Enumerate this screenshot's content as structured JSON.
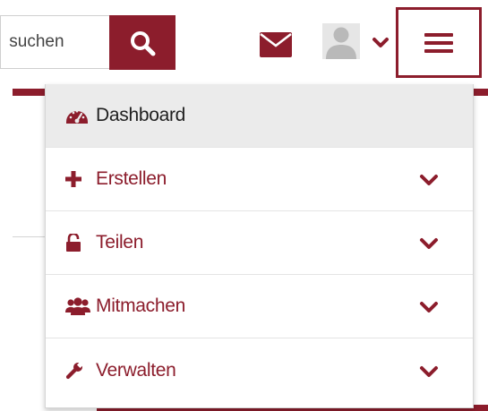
{
  "colors": {
    "accent": "#8c1d2c",
    "active_bg": "#ebebeb",
    "active_text": "#1f1f1f"
  },
  "header": {
    "search": {
      "value": " suchen",
      "button_icon": "search-icon"
    },
    "mail_icon": "envelope-icon",
    "user_icon": "user-avatar-icon",
    "menu_icon": "hamburger-icon"
  },
  "menu": {
    "items": [
      {
        "label": "Dashboard",
        "icon": "dashboard-icon",
        "active": true,
        "expandable": false
      },
      {
        "label": "Erstellen",
        "icon": "plus-icon",
        "active": false,
        "expandable": true
      },
      {
        "label": "Teilen",
        "icon": "unlock-icon",
        "active": false,
        "expandable": true
      },
      {
        "label": "Mitmachen",
        "icon": "users-icon",
        "active": false,
        "expandable": true
      },
      {
        "label": "Verwalten",
        "icon": "wrench-icon",
        "active": false,
        "expandable": true
      }
    ]
  }
}
